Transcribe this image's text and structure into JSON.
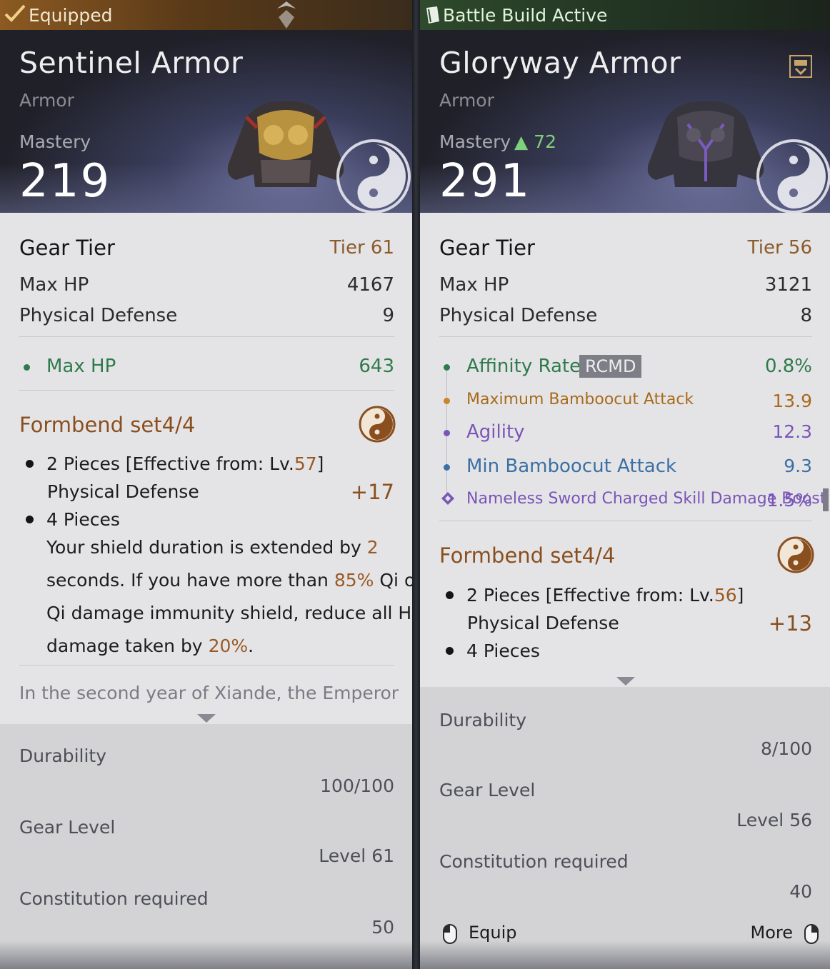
{
  "left": {
    "status": "Equipped",
    "name": "Sentinel Armor",
    "type": "Armor",
    "mastery_label": "Mastery",
    "mastery_value": "219",
    "gear_tier_label": "Gear Tier",
    "gear_tier_value": "Tier 61",
    "stats": [
      {
        "label": "Max HP",
        "value": "4167"
      },
      {
        "label": "Physical Defense",
        "value": "9"
      }
    ],
    "substats": [
      {
        "label": "Max HP",
        "value": "643",
        "color": "#2f7a4c"
      }
    ],
    "set_title": "Formbend set4/4",
    "set_2pc_a": "2 Pieces [Effective from: Lv.",
    "set_2pc_lv": "57",
    "set_2pc_b": "]",
    "set_2pc_stat": "Physical Defense",
    "set_2pc_bonus": "+17",
    "set_4pc": "4 Pieces",
    "set_4pc_l1a": "Your shield duration is extended by ",
    "set_4pc_l1b": "2",
    "set_4pc_l2a": "seconds. If you have more than ",
    "set_4pc_l2b": "85%",
    "set_4pc_l2c": " Qi or a",
    "set_4pc_l3": "Qi damage immunity shield, reduce all HP",
    "set_4pc_l4a": "damage taken by ",
    "set_4pc_l4b": "20%",
    "set_4pc_l4c": ".",
    "lore": "In the second year of Xiande, the Emperor",
    "durability_label": "Durability",
    "durability_value": "100/100",
    "gear_level_label": "Gear Level",
    "gear_level_value": "Level 61",
    "constitution_label": "Constitution required",
    "constitution_value": "50"
  },
  "right": {
    "status": "Battle Build Active",
    "name": "Gloryway Armor",
    "type": "Armor",
    "mastery_label": "Mastery",
    "mastery_delta": "▲ 72",
    "mastery_value": "291",
    "gear_tier_label": "Gear Tier",
    "gear_tier_value": "Tier 56",
    "stats": [
      {
        "label": "Max HP",
        "value": "3121"
      },
      {
        "label": "Physical Defense",
        "value": "8"
      }
    ],
    "substats": [
      {
        "label": "Affinity Rate",
        "badge": "RCMD",
        "value": "0.8%",
        "color": "#2f7a4c"
      },
      {
        "label": "Maximum Bamboocut Attack",
        "value": "13.9",
        "color": "#a86a1c"
      },
      {
        "label": "Agility",
        "value": "12.3",
        "color": "#7a55b8"
      },
      {
        "label": "Min Bamboocut Attack",
        "value": "9.3",
        "color": "#3c6fa3"
      },
      {
        "label": "Nameless Sword Charged Skill Damage Boost",
        "value": "1.5%",
        "color": "#7a55b8"
      }
    ],
    "set_title": "Formbend set4/4",
    "set_2pc_a": "2 Pieces [Effective from: Lv.",
    "set_2pc_lv": "56",
    "set_2pc_b": "]",
    "set_2pc_stat": "Physical Defense",
    "set_2pc_bonus": "+13",
    "set_4pc": "4 Pieces",
    "durability_label": "Durability",
    "durability_value": "8/100",
    "gear_level_label": "Gear Level",
    "gear_level_value": "Level 56",
    "constitution_label": "Constitution required",
    "constitution_value": "40",
    "equip_label": "Equip",
    "more_label": "More"
  },
  "icons": {
    "equipped": "checkmark-icon",
    "battle_build": "book-icon",
    "save": "save-icon",
    "set": "yinyang-icon",
    "mouse": "mouse-icon"
  },
  "colors": {
    "tier": "#8c5a2b",
    "set_title": "#8a4f1e",
    "mastery_up": "#7fd07a"
  }
}
